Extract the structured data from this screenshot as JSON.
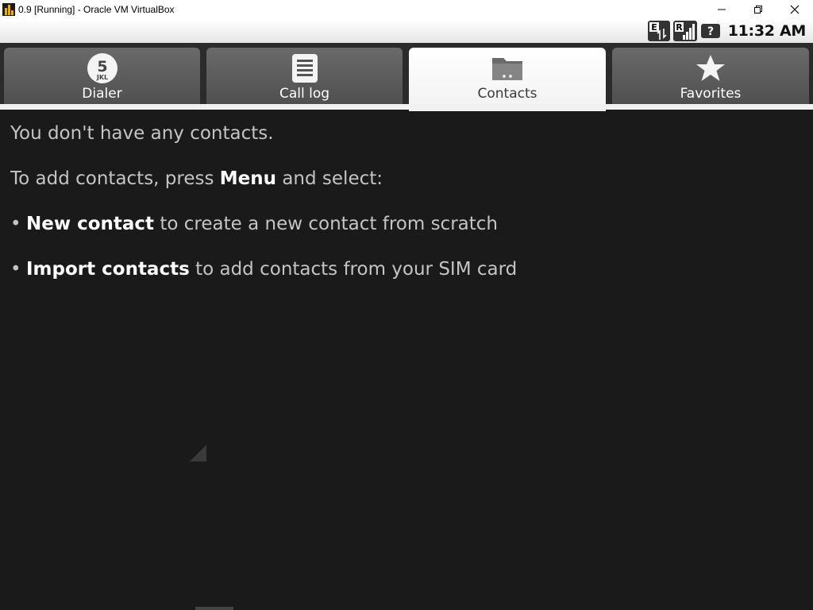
{
  "window": {
    "title": "0.9 [Running] - Oracle VM VirtualBox",
    "icon": "virtualbox-app-icon",
    "controls": [
      "minimize-icon",
      "restore-icon",
      "close-icon"
    ]
  },
  "statusbar": {
    "icons": [
      {
        "name": "edge-data-icon",
        "letter": "E"
      },
      {
        "name": "roaming-signal-icon",
        "letter": "R"
      },
      {
        "name": "no-sim-icon",
        "letter": "?"
      }
    ],
    "time": "11:32 AM"
  },
  "tabs": [
    {
      "label": "Dialer",
      "icon": "dialer-5jkl-icon",
      "icon_digit": "5",
      "icon_letters": "JKL",
      "selected": false
    },
    {
      "label": "Call log",
      "icon": "call-log-icon",
      "selected": false
    },
    {
      "label": "Contacts",
      "icon": "contacts-folder-icon",
      "selected": true
    },
    {
      "label": "Favorites",
      "icon": "star-icon",
      "selected": false
    }
  ],
  "content": {
    "empty_message": "You don't have any contacts.",
    "instruction_prefix": "To add contacts, press ",
    "instruction_bold": "Menu",
    "instruction_suffix": " and select:",
    "bullet_char": "•",
    "options": [
      {
        "bold": "New contact",
        "text": " to create a new contact from scratch"
      },
      {
        "bold": "Import contacts",
        "text": " to add contacts from your SIM card"
      }
    ]
  },
  "colors": {
    "background": "#1a1a1a",
    "text": "#c4c4c4",
    "text_bold": "#ffffff",
    "tab_selected": "#ffffff",
    "tab_unselected": "#5c5c5c"
  }
}
